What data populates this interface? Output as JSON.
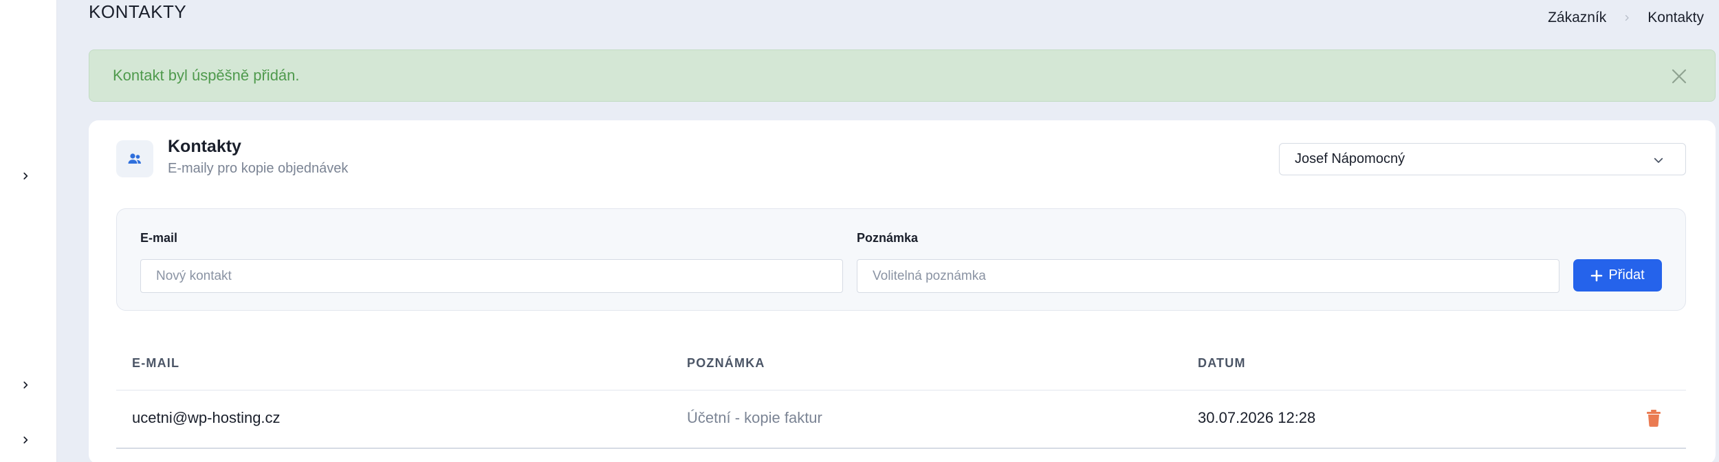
{
  "header": {
    "title": "KONTAKTY",
    "breadcrumb": [
      "Zákazník",
      "Kontakty"
    ]
  },
  "alert": {
    "message": "Kontakt byl úspěšně přidán.",
    "color": "#4f9a4d"
  },
  "card": {
    "icon": "users-icon",
    "title": "Kontakty",
    "subtitle": "E-maily pro kopie objednávek",
    "selected_user": "Josef Nápomocný"
  },
  "form": {
    "email_label": "E-mail",
    "email_placeholder": "Nový kontakt",
    "note_label": "Poznámka",
    "note_placeholder": "Volitelná poznámka",
    "add_label": "Přidat",
    "accent": "#2563eb"
  },
  "table": {
    "columns": [
      "E-MAIL",
      "POZNÁMKA",
      "DATUM"
    ],
    "rows": [
      {
        "email": "ucetni@wp-hosting.cz",
        "note": "Účetní - kopie faktur",
        "date": "30.07.2026 12:28"
      }
    ]
  }
}
